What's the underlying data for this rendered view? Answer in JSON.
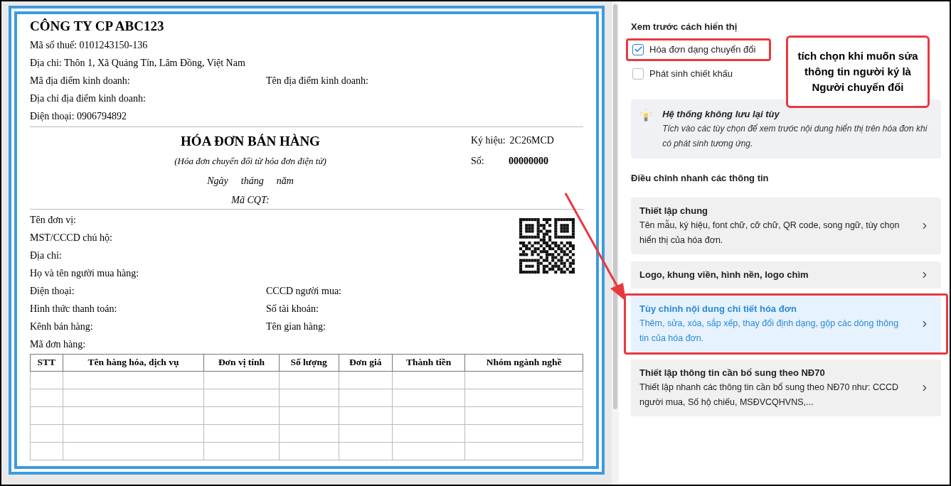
{
  "invoice": {
    "company": "CÔNG TY CP ABC123",
    "seller_lines": [
      {
        "left": "Mã số thuế: 0101243150-136"
      },
      {
        "left": "Địa chỉ: Thôn 1, Xã Quảng Tín, Lâm Đồng, Việt Nam"
      },
      {
        "left": "Mã địa điểm kinh doanh:",
        "right": "Tên địa điểm kinh doanh:"
      },
      {
        "left": "Địa chỉ địa điểm kinh doanh:"
      },
      {
        "left": "Điện thoại: 0906794892"
      }
    ],
    "title": "HÓA ĐƠN BÁN HÀNG",
    "subtitle": "(Hóa đơn chuyển đổi từ hóa đơn điện tử)",
    "date_parts": [
      "Ngày",
      "tháng",
      "năm"
    ],
    "tax_code_label": "Mã CQT:",
    "symbol_label": "Ký hiệu:",
    "symbol": "2C26MCD",
    "number_label": "Số:",
    "number": "00000000",
    "buyer_lines": [
      {
        "left": "Tên đơn vị:"
      },
      {
        "left": "MST/CCCD chủ hộ:"
      },
      {
        "left": "Địa chỉ:"
      },
      {
        "left": "Họ và tên người mua hàng:"
      },
      {
        "left": "Điện thoại:",
        "right": "CCCD người mua:"
      },
      {
        "left": "Hình thức thanh toán:",
        "right": "Số tài khoản:"
      },
      {
        "left": "Kênh bán hàng:",
        "right": "Tên gian hàng:"
      },
      {
        "left": "Mã đơn hàng:"
      }
    ],
    "table": {
      "columns": [
        "STT",
        "Tên hàng hóa, dịch vụ",
        "Đơn vị tính",
        "Số lượng",
        "Đơn giá",
        "Thành tiền",
        "Nhóm ngành nghề"
      ]
    }
  },
  "panel": {
    "preview_title": "Xem trước cách hiển thị",
    "options": [
      {
        "label": "Hóa đơn dạng chuyển đổi",
        "checked": true,
        "highlighted": true
      },
      {
        "label": "Phát sinh chiết khấu",
        "checked": false,
        "highlighted": false
      }
    ],
    "hint": {
      "title": "Hệ thống không lưu lại tùy",
      "text": "Tích vào các tùy chọn để xem trước nội dung hiển thị trên hóa đơn khi có phát sinh tương ứng."
    },
    "quick_title": "Điều chỉnh nhanh các thông tin",
    "cards": [
      {
        "title": "Thiết lập chung",
        "text": "Tên mẫu, ký hiệu, font chữ, cỡ chữ, QR code, song ngữ, tùy chọn hiển thị của hóa đơn.",
        "selected": false,
        "highlighted": false
      },
      {
        "title": "Logo, khung viền, hình nền, logo chìm",
        "selected": false,
        "highlighted": false
      },
      {
        "title": "Tùy chỉnh nội dung chi tiết hóa đơn",
        "text": "Thêm, sửa, xóa, sắp xếp, thay đổi định dạng, gộp các dòng thông tin của hóa đơn.",
        "selected": true,
        "highlighted": true
      },
      {
        "title": "Thiết lập thông tin cần bổ sung theo NĐ70",
        "text": "Thiết lập nhanh các thông tin cần bổ sung theo NĐ70 như: CCCD người mua, Số hộ chiếu, MSĐVCQHVNS,...",
        "selected": false,
        "highlighted": false
      }
    ]
  },
  "callout": {
    "text": "tích chọn khi muốn sửa thông tin người ký là Người chuyển đổi"
  }
}
